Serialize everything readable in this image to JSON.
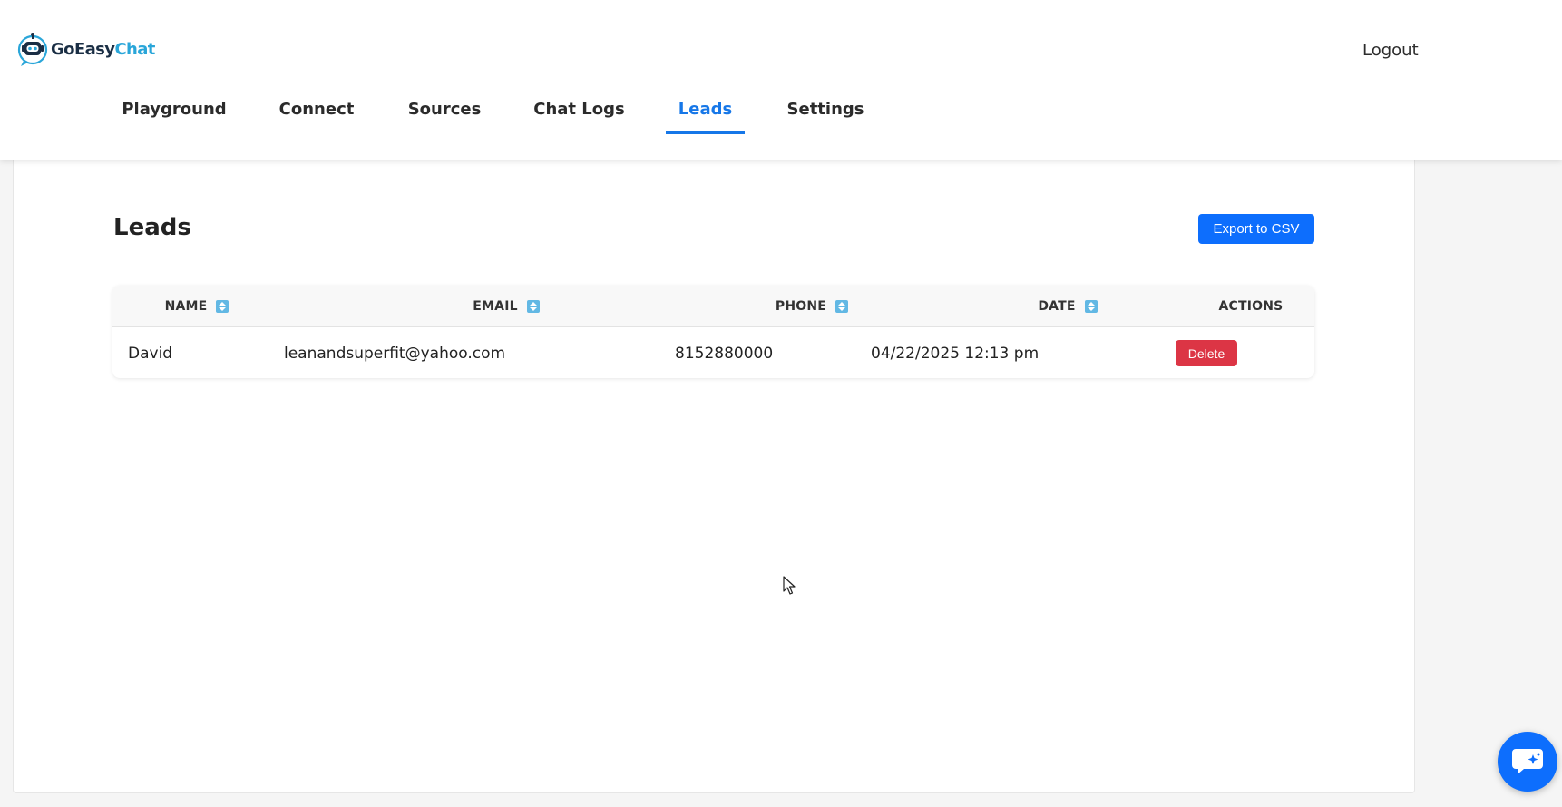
{
  "brand": {
    "name_part1": "GoEasy",
    "name_part2": "Chat",
    "colors": {
      "dark": "#1a2e44",
      "accent": "#2aa6d9"
    }
  },
  "header": {
    "logout_label": "Logout"
  },
  "nav": {
    "tabs": [
      {
        "label": "Playground",
        "active": false
      },
      {
        "label": "Connect",
        "active": false
      },
      {
        "label": "Sources",
        "active": false
      },
      {
        "label": "Chat Logs",
        "active": false
      },
      {
        "label": "Leads",
        "active": true
      },
      {
        "label": "Settings",
        "active": false
      }
    ],
    "active_color": "#1677e8"
  },
  "main": {
    "title": "Leads",
    "export_label": "Export to CSV"
  },
  "table": {
    "columns": [
      {
        "label": "NAME",
        "sortable": true,
        "sort_icon": "sort-icon"
      },
      {
        "label": "EMAIL",
        "sortable": true,
        "sort_icon": "sort-icon"
      },
      {
        "label": "PHONE",
        "sortable": true,
        "sort_icon": "sort-icon"
      },
      {
        "label": "DATE",
        "sortable": true,
        "sort_icon": "sort-icon"
      },
      {
        "label": "ACTIONS",
        "sortable": false
      }
    ],
    "rows": [
      {
        "name": "David",
        "email": "leanandsuperfit@yahoo.com",
        "phone": "8152880000",
        "date": "04/22/2025 12:13 pm",
        "action_label": "Delete"
      }
    ]
  },
  "colors": {
    "primary": "#0d6efd",
    "danger": "#dc3545",
    "sort_icon": "#62b8e4"
  },
  "widget": {
    "icon": "chat-bubble-icon"
  }
}
